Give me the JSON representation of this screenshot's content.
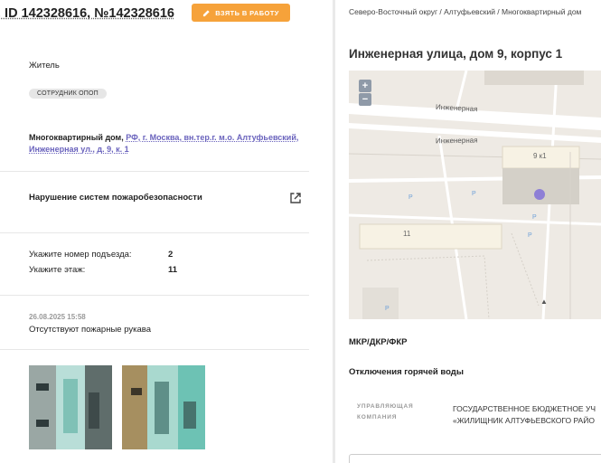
{
  "ticket": {
    "title": ". ID 142328616, №142328616",
    "take_button": "ВЗЯТЬ В РАБОТУ",
    "role": "Житель",
    "badge": "СОТРУДНИК ОПОП",
    "address_prefix": "Многоквартирный дом, ",
    "address_link": "РФ, г. Москва, вн.тер.г. м.о. Алтуфьевский, Инженерная ул., д. 9, к. 1",
    "issue": "Нарушение систем пожаробезопасности",
    "fields": [
      {
        "label": "Укажите номер подъезда:",
        "value": "2"
      },
      {
        "label": "Укажите этаж:",
        "value": "11"
      }
    ],
    "comment_date": "26.08.2025 15:58",
    "comment_text": "Отсутствуют пожарные рукава",
    "photos": [
      "photo-1",
      "photo-2"
    ]
  },
  "panel": {
    "breadcrumb": "Северо-Восточный округ / Алтуфьевский / Многоквартирный дом",
    "address_title": "Инженерная улица, дом 9, корпус 1",
    "map": {
      "zoom_in": "+",
      "zoom_out": "−",
      "street_label_1": "Инженерная",
      "street_label_2": "Инженерная",
      "building_label": "9 к1",
      "building_label_2": "11",
      "parking": "P",
      "marker_color": "#8e7fd6"
    },
    "district_type": "МКР/ДКР/ФКР",
    "hot_water": "Отключения горячей воды",
    "management_label_1": "УПРАВЛЯЮЩАЯ",
    "management_label_2": "КОМПАНИЯ",
    "management_value_1": "ГОСУДАРСТВЕННОЕ БЮДЖЕТНОЕ УЧ",
    "management_value_2": "«ЖИЛИЩНИК АЛТУФЬЕВСКОГО РАЙО"
  },
  "colors": {
    "accent": "#f6a23a",
    "link": "#6a63bd",
    "zoom_button": "#8f9aa8"
  }
}
